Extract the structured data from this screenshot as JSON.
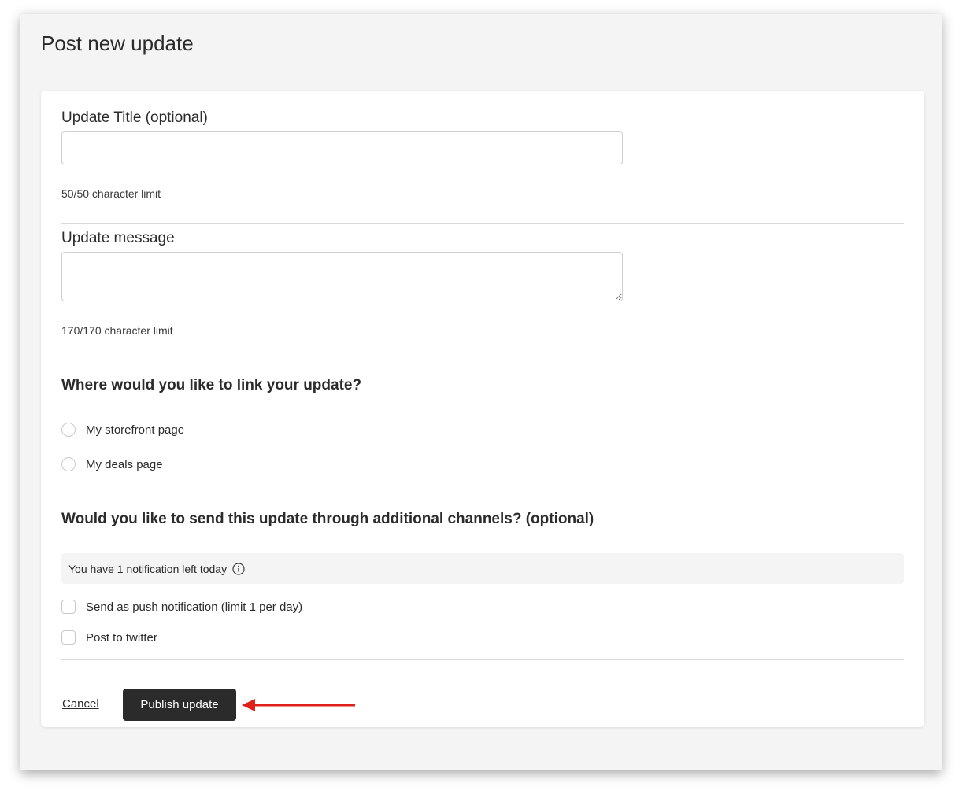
{
  "page": {
    "title": "Post new update"
  },
  "form": {
    "title_field": {
      "label": "Update Title (optional)",
      "value": "",
      "placeholder": "",
      "hint": "50/50 character limit"
    },
    "message_field": {
      "label": "Update message",
      "value": "",
      "placeholder": "",
      "hint": "170/170 character limit"
    },
    "link_section": {
      "heading": "Where would you like to link your update?",
      "options": [
        {
          "label": "My storefront page",
          "selected": false
        },
        {
          "label": "My deals page",
          "selected": false
        }
      ]
    },
    "channels_section": {
      "heading": "Would you like to send this update through additional channels? (optional)",
      "notice": "You have 1 notification left today",
      "notice_icon": "info-icon",
      "options": [
        {
          "label": "Send as push notification (limit 1 per day)",
          "checked": false
        },
        {
          "label": "Post to twitter",
          "checked": false
        }
      ]
    },
    "actions": {
      "cancel_label": "Cancel",
      "publish_label": "Publish update"
    }
  },
  "annotation": {
    "type": "arrow",
    "color": "#e0201b",
    "points_to": "publish-button"
  }
}
